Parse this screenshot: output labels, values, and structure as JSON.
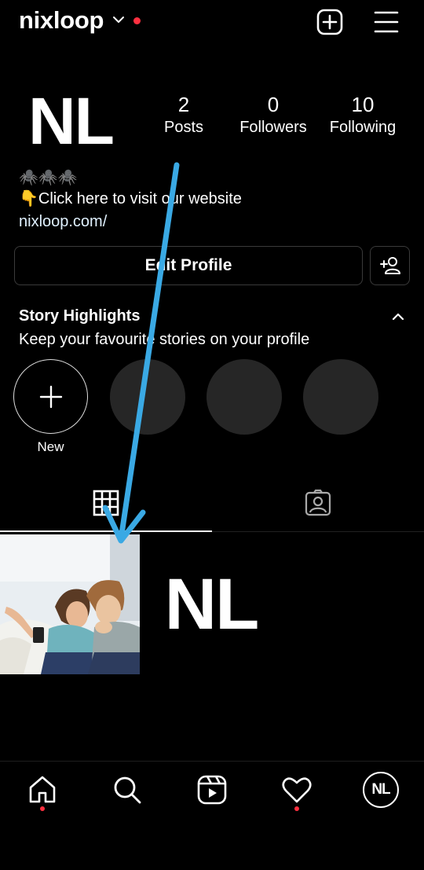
{
  "header": {
    "username": "nixloop",
    "add_icon": "plus-square-icon",
    "menu_icon": "hamburger-menu-icon"
  },
  "profile": {
    "avatar_text": "NL",
    "stats": [
      {
        "value": "2",
        "label": "Posts"
      },
      {
        "value": "0",
        "label": "Followers"
      },
      {
        "value": "10",
        "label": "Following"
      }
    ],
    "bio_line1": "🕷️🕷️🕷️",
    "bio_line2": "👇Click here to visit our website",
    "bio_link": "nixloop.com/"
  },
  "actions": {
    "edit_profile": "Edit Profile",
    "add_user_icon": "add-user-icon"
  },
  "story_highlights": {
    "title": "Story Highlights",
    "subtitle": "Keep your favourite stories on your profile",
    "new_label": "New"
  },
  "grid": {
    "post2_text": "NL"
  },
  "bottom_nav": {
    "avatar_text": "NL",
    "items": [
      "home-icon",
      "search-icon",
      "reels-icon",
      "heart-icon",
      "profile-avatar"
    ]
  },
  "colors": {
    "background": "#000000",
    "notification_dot": "#ff3040",
    "highlight_placeholder": "#262626",
    "annotation_arrow": "#3aa9e4"
  }
}
